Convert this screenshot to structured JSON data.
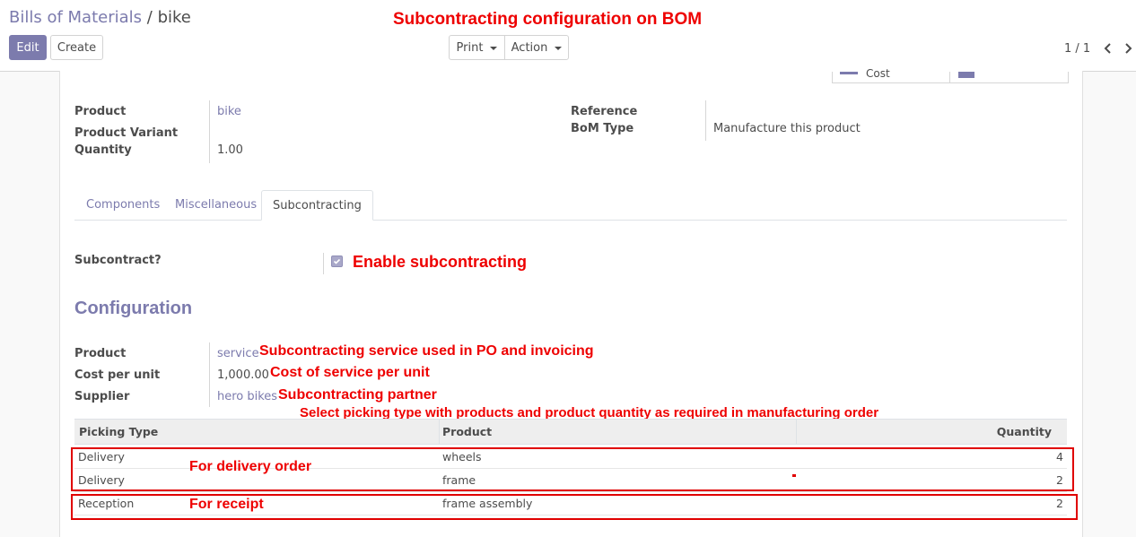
{
  "breadcrumb": {
    "parent": "Bills of Materials",
    "separator": "/",
    "current": "bike"
  },
  "toolbar": {
    "edit_label": "Edit",
    "create_label": "Create",
    "print_label": "Print",
    "action_label": "Action"
  },
  "pager": {
    "value": "1 / 1"
  },
  "smart_buttons": {
    "cost_label": "Cost"
  },
  "header_title": "Subcontracting configuration on BOM",
  "form": {
    "product_label": "Product",
    "product_value": "bike",
    "variant_label": "Product Variant",
    "quantity_label": "Quantity",
    "quantity_value": "1.00",
    "reference_label": "Reference",
    "bom_type_label": "BoM Type",
    "bom_type_value": "Manufacture this product"
  },
  "tabs": [
    {
      "label": "Components"
    },
    {
      "label": "Miscellaneous"
    },
    {
      "label": "Subcontracting"
    }
  ],
  "subcontract": {
    "label": "Subcontract?",
    "checked": true,
    "note": "Enable subcontracting"
  },
  "configuration": {
    "title": "Configuration",
    "product_label": "Product",
    "product_value": "service",
    "product_note": "Subcontracting service used in PO and invoicing",
    "cost_label": "Cost per unit",
    "cost_value": "1,000.00",
    "cost_note": "Cost of service per unit",
    "supplier_label": "Supplier",
    "supplier_value": "hero bikes",
    "supplier_note": "Subcontracting partner"
  },
  "table_note": "Select picking type with products and product quantity as required in manufacturing order",
  "table": {
    "headers": [
      "Picking Type",
      "Product",
      "Quantity"
    ],
    "rows": [
      {
        "picking_type": "Delivery",
        "product": "wheels",
        "quantity": "4"
      },
      {
        "picking_type": "Delivery",
        "product": "frame",
        "quantity": "2"
      },
      {
        "picking_type": "Reception",
        "product": "frame assembly",
        "quantity": "2"
      }
    ]
  },
  "annotations": {
    "delivery_note": "For delivery order",
    "receipt_note": "For receipt"
  },
  "colors": {
    "accent": "#7c7bad",
    "annotation": "#ee0000"
  }
}
